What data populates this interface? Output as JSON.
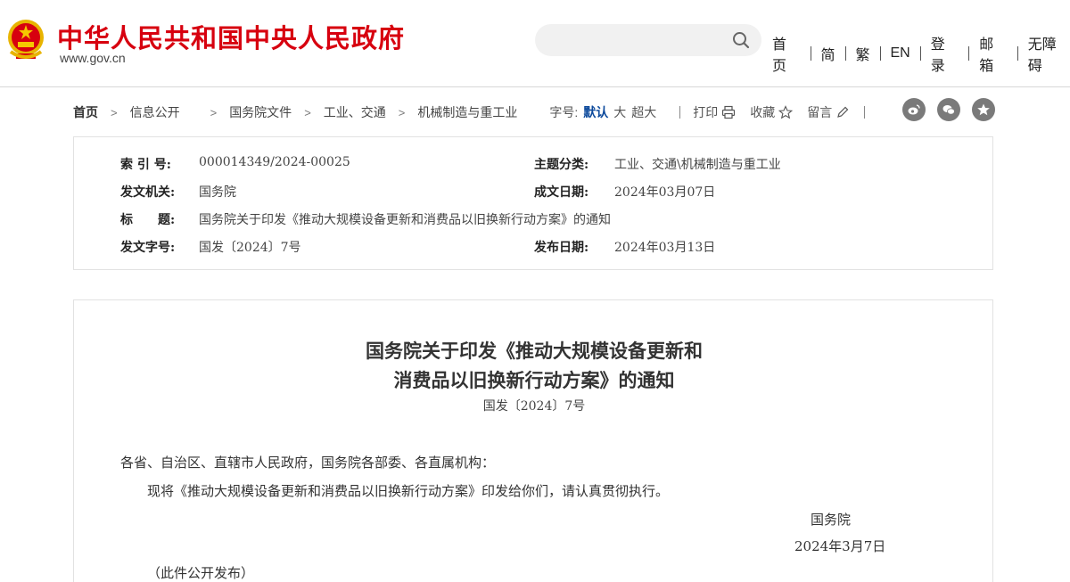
{
  "header": {
    "site_title": "中华人民共和国中央人民政府",
    "site_url": "www.gov.cn",
    "search_placeholder": "",
    "nav": [
      "首页",
      "简",
      "繁",
      "EN",
      "登录",
      "邮箱",
      "无障碍"
    ]
  },
  "breadcrumb": {
    "items": [
      "首页",
      "信息公开",
      "国务院文件",
      "工业、交通",
      "机械制造与重工业"
    ],
    "font_label": "字号:",
    "font_sizes": [
      "默认",
      "大",
      "超大"
    ],
    "tools": [
      "打印",
      "收藏",
      "留言"
    ],
    "socials": [
      "weibo-icon",
      "wechat-icon",
      "qzone-icon"
    ]
  },
  "meta": {
    "index_label": "索 引 号:",
    "index_value": "000014349/2024-00025",
    "category_label": "主题分类:",
    "category_value": "工业、交通\\机械制造与重工业",
    "issuer_label": "发文机关:",
    "issuer_value": "国务院",
    "date_label": "成文日期:",
    "date_value": "2024年03月07日",
    "title_label": "标　　题:",
    "title_value": "国务院关于印发《推动大规模设备更新和消费品以旧换新行动方案》的通知",
    "docno_label": "发文字号:",
    "docno_value": "国发〔2024〕7号",
    "publish_label": "发布日期:",
    "publish_value": "2024年03月13日"
  },
  "doc": {
    "title_line1": "国务院关于印发《推动大规模设备更新和",
    "title_line2": "消费品以旧换新行动方案》的通知",
    "doc_no": "国发〔2024〕7号",
    "salutation": "各省、自治区、直辖市人民政府，国务院各部委、各直属机构：",
    "body": "现将《推动大规模设备更新和消费品以旧换新行动方案》印发给你们，请认真贯彻执行。",
    "signer": "国务院",
    "sign_date": "2024年3月7日",
    "note": "（此件公开发布）"
  },
  "colors": {
    "brand_red": "#d7000f",
    "accent_blue": "#0d4a9c"
  }
}
